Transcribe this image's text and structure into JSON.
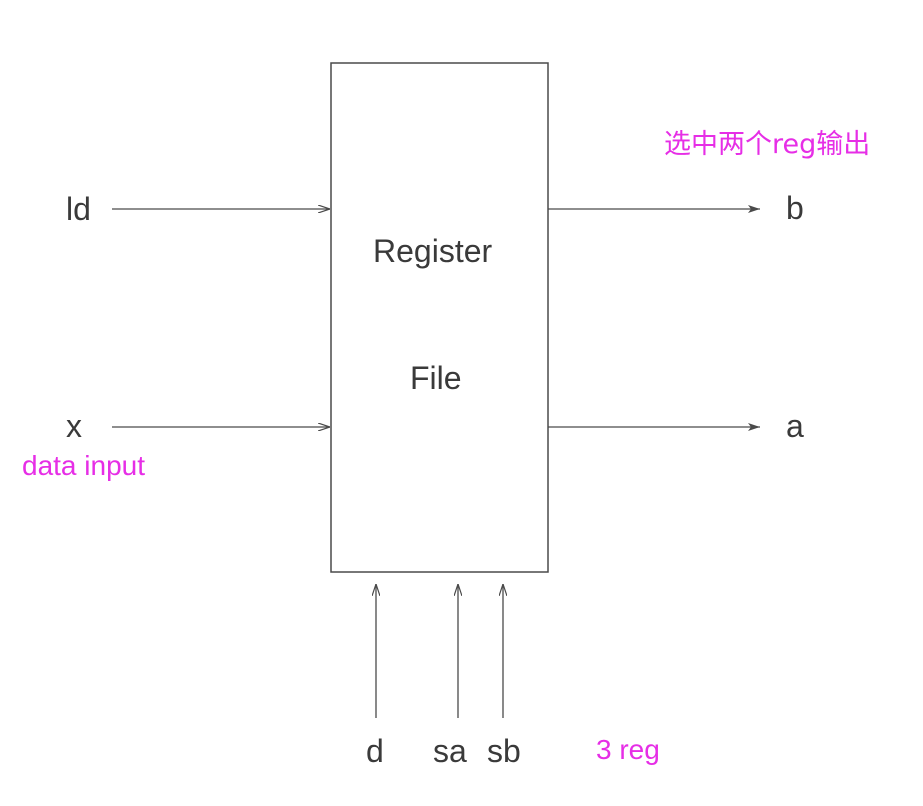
{
  "block": {
    "title_line1": "Register",
    "title_line2": "File"
  },
  "inputs": {
    "ld": "ld",
    "x": "x",
    "d": "d",
    "sa": "sa",
    "sb": "sb"
  },
  "outputs": {
    "b": "b",
    "a": "a"
  },
  "annotations": {
    "outputs_note": "选中两个reg输出",
    "data_note": "data input",
    "reg_note": "3 reg",
    "color": "#e62ee6"
  },
  "colors": {
    "line": "#4a4a4a",
    "text": "#3a3a3a",
    "annotation": "#e62ee6"
  }
}
